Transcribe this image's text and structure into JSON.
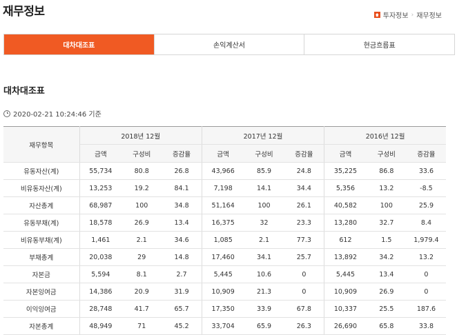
{
  "page": {
    "title": "재무정보"
  },
  "breadcrumb": {
    "items": [
      "투자정보",
      "재무정보"
    ]
  },
  "tabs": [
    {
      "label": "대차대조표",
      "active": true
    },
    {
      "label": "손익계산서",
      "active": false
    },
    {
      "label": "현금흐름표",
      "active": false
    }
  ],
  "section": {
    "title": "대차대조표",
    "as_of": "2020-02-21 10:24:46 기준"
  },
  "table": {
    "row_header": "재무항목",
    "years": [
      "2018년 12월",
      "2017년 12월",
      "2016년 12월"
    ],
    "sub_headers": [
      "금액",
      "구성비",
      "증감율"
    ],
    "rows": [
      {
        "label": "유동자산(계)",
        "values": [
          "55,734",
          "80.8",
          "26.8",
          "43,966",
          "85.9",
          "24.8",
          "35,225",
          "86.8",
          "33.6"
        ]
      },
      {
        "label": "비유동자산(계)",
        "values": [
          "13,253",
          "19.2",
          "84.1",
          "7,198",
          "14.1",
          "34.4",
          "5,356",
          "13.2",
          "-8.5"
        ]
      },
      {
        "label": "자산총계",
        "values": [
          "68,987",
          "100",
          "34.8",
          "51,164",
          "100",
          "26.1",
          "40,582",
          "100",
          "25.9"
        ]
      },
      {
        "label": "유동부채(계)",
        "values": [
          "18,578",
          "26.9",
          "13.4",
          "16,375",
          "32",
          "23.3",
          "13,280",
          "32.7",
          "8.4"
        ]
      },
      {
        "label": "비유동부채(계)",
        "values": [
          "1,461",
          "2.1",
          "34.6",
          "1,085",
          "2.1",
          "77.3",
          "612",
          "1.5",
          "1,979.4"
        ]
      },
      {
        "label": "부채총계",
        "values": [
          "20,038",
          "29",
          "14.8",
          "17,460",
          "34.1",
          "25.7",
          "13,892",
          "34.2",
          "13.2"
        ]
      },
      {
        "label": "자본금",
        "values": [
          "5,594",
          "8.1",
          "2.7",
          "5,445",
          "10.6",
          "0",
          "5,445",
          "13.4",
          "0"
        ]
      },
      {
        "label": "자본잉여금",
        "values": [
          "14,386",
          "20.9",
          "31.9",
          "10,909",
          "21.3",
          "0",
          "10,909",
          "26.9",
          "0"
        ]
      },
      {
        "label": "이익잉여금",
        "values": [
          "28,748",
          "41.7",
          "65.7",
          "17,350",
          "33.9",
          "67.8",
          "10,337",
          "25.5",
          "187.6"
        ]
      },
      {
        "label": "자본총계",
        "values": [
          "48,949",
          "71",
          "45.2",
          "33,704",
          "65.9",
          "26.3",
          "26,690",
          "65.8",
          "33.8"
        ]
      }
    ]
  }
}
